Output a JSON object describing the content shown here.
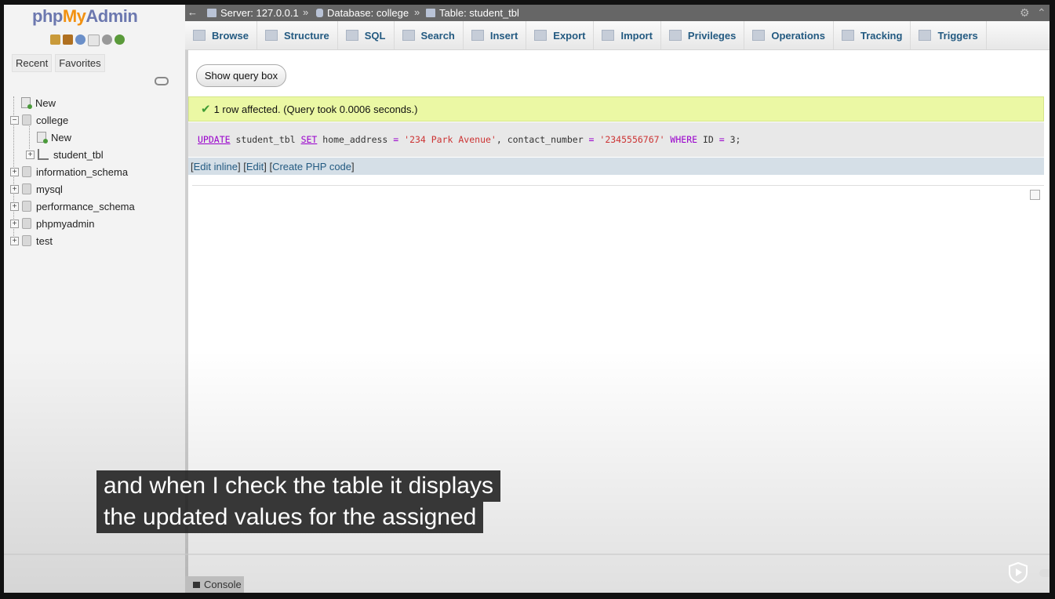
{
  "logo": {
    "part1": "php",
    "part2": "My",
    "part3": "Admin"
  },
  "nav": {
    "recent": "Recent",
    "favorites": "Favorites",
    "tree": [
      {
        "label": "New",
        "level": 0
      },
      {
        "label": "college",
        "level": 0,
        "expanded": true
      },
      {
        "label": "New",
        "level": 1
      },
      {
        "label": "student_tbl",
        "level": 1
      },
      {
        "label": "information_schema",
        "level": 0
      },
      {
        "label": "mysql",
        "level": 0
      },
      {
        "label": "performance_schema",
        "level": 0
      },
      {
        "label": "phpmyadmin",
        "level": 0
      },
      {
        "label": "test",
        "level": 0
      }
    ]
  },
  "breadcrumb": {
    "server": "Server: 127.0.0.1",
    "database": "Database: college",
    "table": "Table: student_tbl",
    "separator": "»"
  },
  "menu": [
    "Browse",
    "Structure",
    "SQL",
    "Search",
    "Insert",
    "Export",
    "Import",
    "Privileges",
    "Operations",
    "Tracking",
    "Triggers"
  ],
  "main": {
    "show_query_box": "Show query box",
    "success_message": "1 row affected. (Query took 0.0006 seconds.)",
    "sql": {
      "kw_update": "UPDATE",
      "table": " student_tbl ",
      "kw_set": "SET",
      "p1": " home_address ",
      "eq1": "=",
      "s1": " '234 Park Avenue'",
      "p2": ", contact_number ",
      "eq2": "=",
      "s2": " '2345556767' ",
      "kw_where": "WHERE",
      "p3": " ID ",
      "eq3": "=",
      "p4": " 3;"
    },
    "links": {
      "open1": "[ ",
      "edit_inline": "Edit inline",
      "mid1": " ] [ ",
      "edit": "Edit",
      "mid2": " ] [ ",
      "create_php": "Create PHP code",
      "close": " ]"
    }
  },
  "console": "Console",
  "caption": {
    "line1": "and when I check the table it displays",
    "line2": "the updated values for the assigned"
  },
  "colors": {
    "accent": "#235a81",
    "success_bg": "#ebf8a4",
    "topbar": "#666666"
  }
}
